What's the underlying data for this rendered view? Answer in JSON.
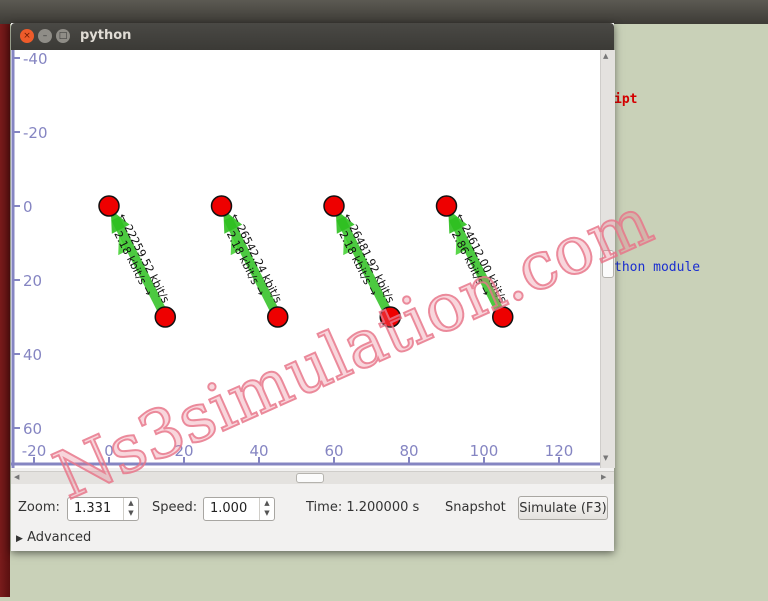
{
  "background": {
    "code_line_1": "ipt",
    "code_line_2": "thon module"
  },
  "window": {
    "title": "python",
    "close_glyph": "×",
    "min_glyph": "–",
    "max_glyph": "□"
  },
  "axes": {
    "x_ticks": [
      -20,
      0,
      20,
      40,
      60,
      80,
      100,
      120
    ],
    "y_ticks": [
      -40,
      -20,
      0,
      20,
      40,
      60
    ],
    "x_range": [
      -26,
      128
    ],
    "y_range": [
      -42,
      63
    ],
    "color": "#8585c2"
  },
  "nodes": [
    {
      "x": 0,
      "y": 0
    },
    {
      "x": 15,
      "y": 30
    },
    {
      "x": 30,
      "y": 0
    },
    {
      "x": 45,
      "y": 30
    },
    {
      "x": 60,
      "y": 0
    },
    {
      "x": 75,
      "y": 30
    },
    {
      "x": 90,
      "y": 0
    },
    {
      "x": 105,
      "y": 30
    }
  ],
  "links": [
    {
      "from": 0,
      "to": 1,
      "forward": "2.18 kbit/s →",
      "reverse": "← 22259.52 kbit/s"
    },
    {
      "from": 2,
      "to": 3,
      "forward": "2.18 kbit/s →",
      "reverse": "← 26542.24 kbit/s"
    },
    {
      "from": 4,
      "to": 5,
      "forward": "2.18 kbit/s →",
      "reverse": "← 26481.92 kbit/s"
    },
    {
      "from": 6,
      "to": 7,
      "forward": "2.86 kbit/s →",
      "reverse": "← 24612.00 kbit/s"
    }
  ],
  "controls": {
    "zoom_label": "Zoom:",
    "zoom_value": "1.331",
    "speed_label": "Speed:",
    "speed_value": "1.000",
    "time_text": "Time: 1.200000 s",
    "snapshot_label": "Snapshot",
    "simulate_label": "Simulate (F3)",
    "advanced_label": "Advanced",
    "step_up": "▲",
    "step_down": "▼",
    "expander": "▶"
  },
  "watermark": {
    "text": "Ns3simulation.com",
    "color": "#e8768a"
  }
}
